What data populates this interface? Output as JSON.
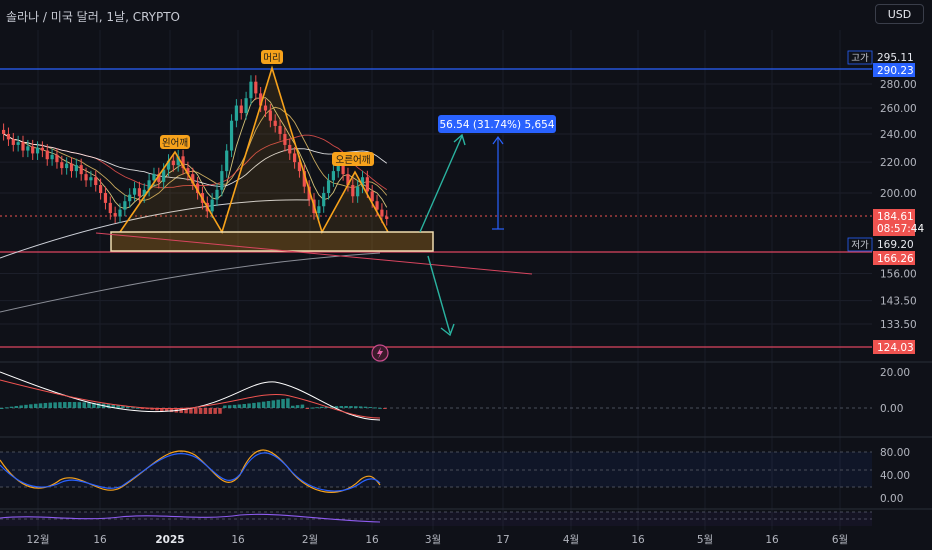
{
  "header": {
    "title": "솔라나 / 미국 달러, 1날, CRYPTO",
    "currency_button": "USD"
  },
  "colors": {
    "bg": "#0f1118",
    "up": "#26a69a",
    "down": "#ef5350",
    "accent_blue": "#2962ff",
    "label_orange": "#f7a21b",
    "teal_arrow": "#2ab3a0",
    "pink_line": "#d9455f"
  },
  "chart_data": {
    "type": "candlestick",
    "price_axis": {
      "ticks": [
        280.0,
        260.0,
        240.0,
        220.0,
        200.0,
        156.0,
        143.5,
        133.5
      ],
      "scale": "log"
    },
    "price_labels": {
      "high": {
        "tag": "고가",
        "value": "295.11"
      },
      "current_high": {
        "value": "290.23"
      },
      "last_price": {
        "value": "184.61",
        "countdown": "08:57:44"
      },
      "low": {
        "tag": "저가",
        "value": "169.20"
      },
      "support": {
        "value": "166.26"
      },
      "target": {
        "value": "124.03"
      }
    },
    "time_axis": [
      "12월",
      "16",
      "2025",
      "16",
      "2월",
      "16",
      "3월",
      "17",
      "4월",
      "16",
      "5월",
      "16",
      "6월"
    ],
    "pattern": "head-and-shoulders",
    "pattern_labels": {
      "left_shoulder": "왼어깨",
      "head": "머리",
      "right_shoulder": "오른어깨"
    },
    "measure_label": "56.54 (31.74%) 5,654",
    "closes": [
      240,
      236,
      232,
      234,
      228,
      231,
      226,
      230,
      228,
      222,
      225,
      220,
      216,
      219,
      214,
      218,
      212,
      208,
      210,
      205,
      200,
      194,
      188,
      186,
      190,
      195,
      199,
      203,
      198,
      202,
      208,
      212,
      207,
      215,
      221,
      218,
      224,
      216,
      212,
      206,
      200,
      194,
      189,
      196,
      202,
      214,
      228,
      250,
      262,
      256,
      268,
      282,
      272,
      262,
      258,
      250,
      246,
      240,
      232,
      226,
      220,
      214,
      204,
      196,
      188,
      192,
      200,
      208,
      214,
      220,
      212,
      205,
      198,
      204,
      210,
      201,
      195,
      190,
      186,
      184.61
    ],
    "macd_ticks": [
      "20.00",
      "0.00"
    ],
    "stoch_ticks": [
      "80.00",
      "40.00",
      "0.00"
    ]
  }
}
